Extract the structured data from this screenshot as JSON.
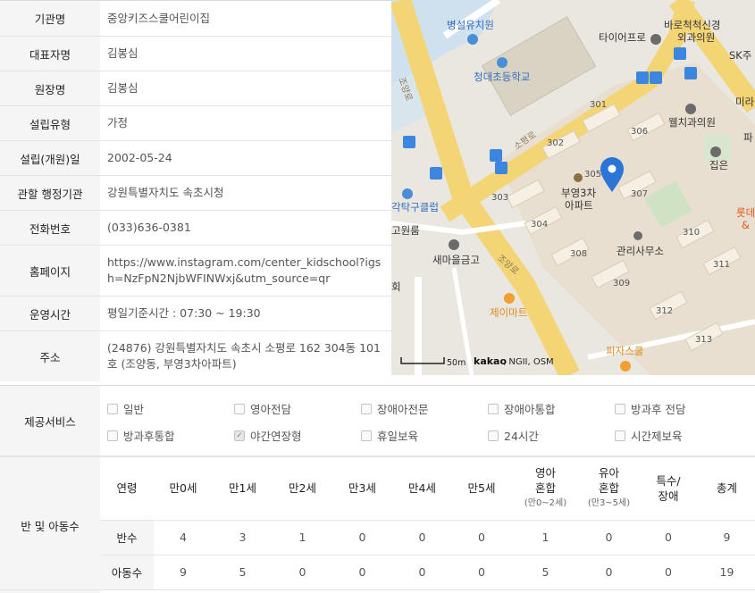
{
  "info": [
    {
      "label": "기관명",
      "value": "중앙키즈스쿨어린이집"
    },
    {
      "label": "대표자명",
      "value": "김봉심"
    },
    {
      "label": "원장명",
      "value": "김봉심"
    },
    {
      "label": "설립유형",
      "value": "가정"
    },
    {
      "label": "설립(개원)일",
      "value": "2002-05-24"
    },
    {
      "label": "관할 행정기관",
      "value": "강원특별자치도 속초시청"
    },
    {
      "label": "전화번호",
      "value": "(033)636-0381"
    },
    {
      "label": "홈페이지",
      "value": "https://www.instagram.com/center_kidschool?igsh=NzFpN2NjbWFINWxj&utm_source=qr"
    },
    {
      "label": "운영시간",
      "value": "평일기준시간 : 07:30 ~ 19:30"
    },
    {
      "label": "주소",
      "value": "(24876) 강원특별자치도 속초시 소평로 162 304동 101호 (조양동, 부영3차아파트)"
    }
  ],
  "map": {
    "labels": {
      "hospital": "병설유치원",
      "school": "청대초등학교",
      "tire": "타이어프로",
      "clinic_top": "바로척척신경",
      "clinic_top2": "외과의원",
      "sk": "SK주",
      "mira": "미라",
      "dental": "웰치과의원",
      "jip": "집은",
      "apt": "부영3차",
      "apt2": "아파트",
      "office": "관리사무소",
      "club": "각탁구클럽",
      "room": "고원룸",
      "bank": "새마을금고",
      "mart": "제이마트",
      "pizza": "피자스쿨",
      "lotte": "롯데",
      "amp": "&",
      "hoe": "회",
      "pa": "파",
      "road1": "조양로",
      "road2": "소평로",
      "road3": "조양로",
      "road_left": "조양로",
      "b301": "301",
      "b302": "302",
      "b303": "303",
      "b304": "304",
      "b305": "305",
      "b306": "306",
      "b307": "307",
      "b308": "308",
      "b309": "309",
      "b310": "310",
      "b311": "311",
      "b312": "312",
      "b313": "313"
    },
    "scale": "50m",
    "attribution_brand": "kakao",
    "attribution_rest": ", NGII, OSM"
  },
  "services": {
    "label": "제공서비스",
    "items": [
      {
        "label": "일반",
        "checked": false
      },
      {
        "label": "영아전담",
        "checked": false
      },
      {
        "label": "장애아전문",
        "checked": false
      },
      {
        "label": "장애아통합",
        "checked": false
      },
      {
        "label": "방과후 전담",
        "checked": false
      },
      {
        "label": "방과후통합",
        "checked": false
      },
      {
        "label": "야간연장형",
        "checked": true
      },
      {
        "label": "휴일보육",
        "checked": false
      },
      {
        "label": "24시간",
        "checked": false
      },
      {
        "label": "시간제보육",
        "checked": false
      }
    ]
  },
  "classes": {
    "label": "반 및 아동수",
    "header": {
      "age": "연령",
      "c0": "만0세",
      "c1": "만1세",
      "c2": "만2세",
      "c3": "만3세",
      "c4": "만4세",
      "c5": "만5세",
      "infant_mix_1": "영아",
      "infant_mix_2": "혼합",
      "infant_mix_sub": "(만0~2세)",
      "child_mix_1": "유아",
      "child_mix_2": "혼합",
      "child_mix_sub": "(만3~5세)",
      "special_1": "특수/",
      "special_2": "장애",
      "total": "총계"
    },
    "rows": [
      {
        "label": "반수",
        "values": [
          "4",
          "3",
          "1",
          "0",
          "0",
          "0",
          "1",
          "0",
          "0",
          "9"
        ]
      },
      {
        "label": "아동수",
        "values": [
          "9",
          "5",
          "0",
          "0",
          "0",
          "0",
          "5",
          "0",
          "0",
          "19"
        ]
      }
    ]
  }
}
